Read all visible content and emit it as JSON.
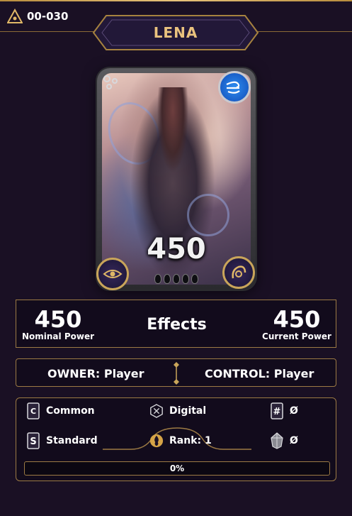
{
  "header": {
    "card_code": "00-030",
    "card_name": "LENA",
    "code_icon": "triangle-eye-icon"
  },
  "card": {
    "power_display": "450",
    "element_icon": "wind-element-icon",
    "left_button_icon": "eye-icon",
    "right_button_icon": "horn-icon",
    "pip_count": 5,
    "colors": {
      "accent_gold": "#c9a55a",
      "element_blue": "#2d8df0"
    }
  },
  "stats": {
    "nominal_power_value": "450",
    "nominal_power_label": "Nominal Power",
    "effects_label": "Effects",
    "current_power_value": "450",
    "current_power_label": "Current Power"
  },
  "ownership": {
    "owner_text": "OWNER: Player",
    "control_text": "CONTROL: Player"
  },
  "info": {
    "rarity": {
      "icon": "rarity-card-icon",
      "label": "Common"
    },
    "medium": {
      "icon": "digital-icon",
      "label": "Digital"
    },
    "serial": {
      "icon": "hash-icon",
      "label": "Ø"
    },
    "format": {
      "icon": "standard-s-icon",
      "label": "Standard"
    },
    "rank": {
      "icon": "rank-flame-icon",
      "label": "Rank: 1"
    },
    "crystal": {
      "icon": "crystal-icon",
      "label": "Ø"
    },
    "progress": {
      "value_fraction": 0.0,
      "label": "0%"
    }
  }
}
